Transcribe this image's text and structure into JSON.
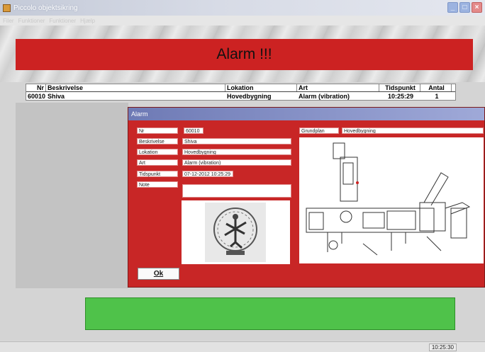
{
  "window": {
    "title": "Piccolo objektsikring"
  },
  "menu": {
    "items": [
      "Filer",
      "Funktioner",
      "Funktioner",
      "Hjælp"
    ]
  },
  "banner": {
    "text": "Alarm !!!"
  },
  "list": {
    "headers": {
      "nr": "Nr",
      "beskrivelse": "Beskrivelse",
      "lokation": "Lokation",
      "art": "Art",
      "tidspunkt": "Tidspunkt",
      "antal": "Antal"
    },
    "rows": [
      {
        "nr": "60010",
        "beskrivelse": "Shiva",
        "lokation": "Hovedbygning",
        "art": "Alarm (vibration)",
        "tidspunkt": "10:25:29",
        "antal": "1"
      }
    ]
  },
  "dialog": {
    "title": "Alarm",
    "labels": {
      "nr": "Nr",
      "beskrivelse": "Beskrivelse",
      "lokation": "Lokation",
      "art": "Art",
      "tidspunkt": "Tidspunkt",
      "note": "Note",
      "grundplan": "Grundplan"
    },
    "values": {
      "nr": "60010",
      "beskrivelse": "Shiva",
      "lokation": "Hovedbygning",
      "art": "Alarm (vibration)",
      "tidspunkt": "07-12-2012 10:25:29",
      "note": "",
      "grundplan": "Hovedbygning"
    },
    "ok_label": "Ok"
  },
  "statusbar": {
    "clock": "10:25:30"
  },
  "colors": {
    "alarm_red": "#cc2222",
    "ok_green": "#4fc24a"
  }
}
